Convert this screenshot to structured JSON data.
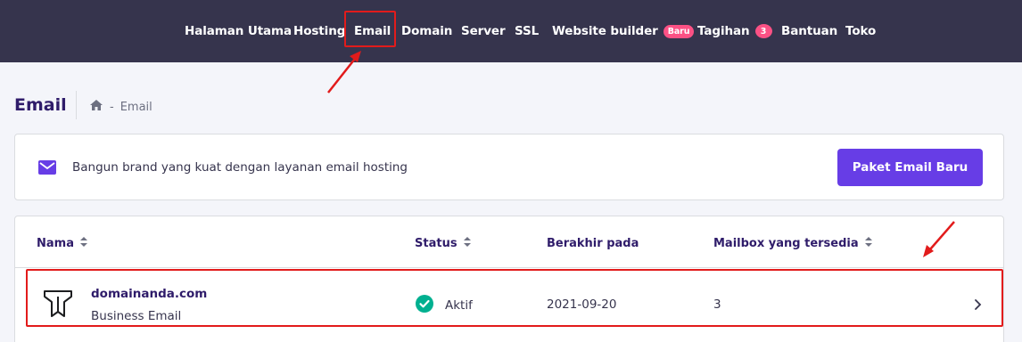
{
  "nav": {
    "items": [
      {
        "label": "Halaman Utama"
      },
      {
        "label": "Hosting"
      },
      {
        "label": "Email"
      },
      {
        "label": "Domain"
      },
      {
        "label": "Server"
      },
      {
        "label": "SSL"
      },
      {
        "label": "Website builder",
        "badge": "Baru"
      },
      {
        "label": "Tagihan",
        "badge": "3"
      },
      {
        "label": "Bantuan"
      },
      {
        "label": "Toko"
      }
    ],
    "active": "Email"
  },
  "page": {
    "title": "Email",
    "breadcrumb_current": "Email"
  },
  "banner": {
    "text": "Bangun brand yang kuat dengan layanan email hosting",
    "button_label": "Paket Email Baru"
  },
  "table": {
    "headers": {
      "name": "Nama",
      "status": "Status",
      "expiry": "Berakhir pada",
      "mailboxes": "Mailbox yang tersedia"
    },
    "rows": [
      {
        "domain": "domainanda.com",
        "plan": "Business Email",
        "status": "Aktif",
        "expiry": "2021-09-20",
        "mailboxes": "3"
      }
    ]
  },
  "colors": {
    "nav_bg": "#36344d",
    "accent": "#673de6",
    "badge": "#fc5185",
    "status_ok": "#00b090",
    "annotation": "#e21b1b"
  },
  "icons": {
    "home": "home-icon",
    "mail": "mail-icon",
    "sort": "sort-icon",
    "status": "check-circle-icon",
    "row_action": "chevron-right-icon",
    "product": "titan-email-logo-icon"
  }
}
